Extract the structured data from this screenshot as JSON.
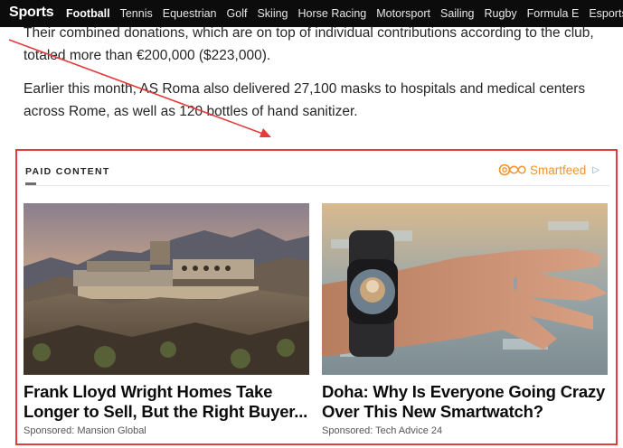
{
  "nav": {
    "brand": "Sports",
    "items": [
      {
        "label": "Football",
        "active": true
      },
      {
        "label": "Tennis"
      },
      {
        "label": "Equestrian"
      },
      {
        "label": "Golf"
      },
      {
        "label": "Skiing"
      },
      {
        "label": "Horse Racing"
      },
      {
        "label": "Motorsport"
      },
      {
        "label": "Sailing"
      },
      {
        "label": "Rugby"
      },
      {
        "label": "Formula E"
      },
      {
        "label": "Esports"
      }
    ]
  },
  "article": {
    "para1": "Their combined donations, which are on top of individual contributions according to the club, totaled more than €200,000 ($223,000).",
    "para2": "Earlier this month, AS Roma also delivered 27,100 masks to hospitals and medical centers across Rome, as well as 120 bottles of hand sanitizer."
  },
  "paid": {
    "header": "PAID CONTENT",
    "provider": "Smartfeed",
    "ad_marker": "▷",
    "cards": [
      {
        "title": "Frank Lloyd Wright Homes Take Longer to Sell, But the Right Buyer...",
        "sponsor": "Sponsored: Mansion Global"
      },
      {
        "title": "Doha: Why Is Everyone Going Crazy Over This New Smartwatch?",
        "sponsor": "Sponsored: Tech Advice 24"
      }
    ]
  },
  "colors": {
    "nav_bg": "#0c0c0c",
    "annotation": "#e43b3b",
    "smartfeed": "#f0932b"
  }
}
